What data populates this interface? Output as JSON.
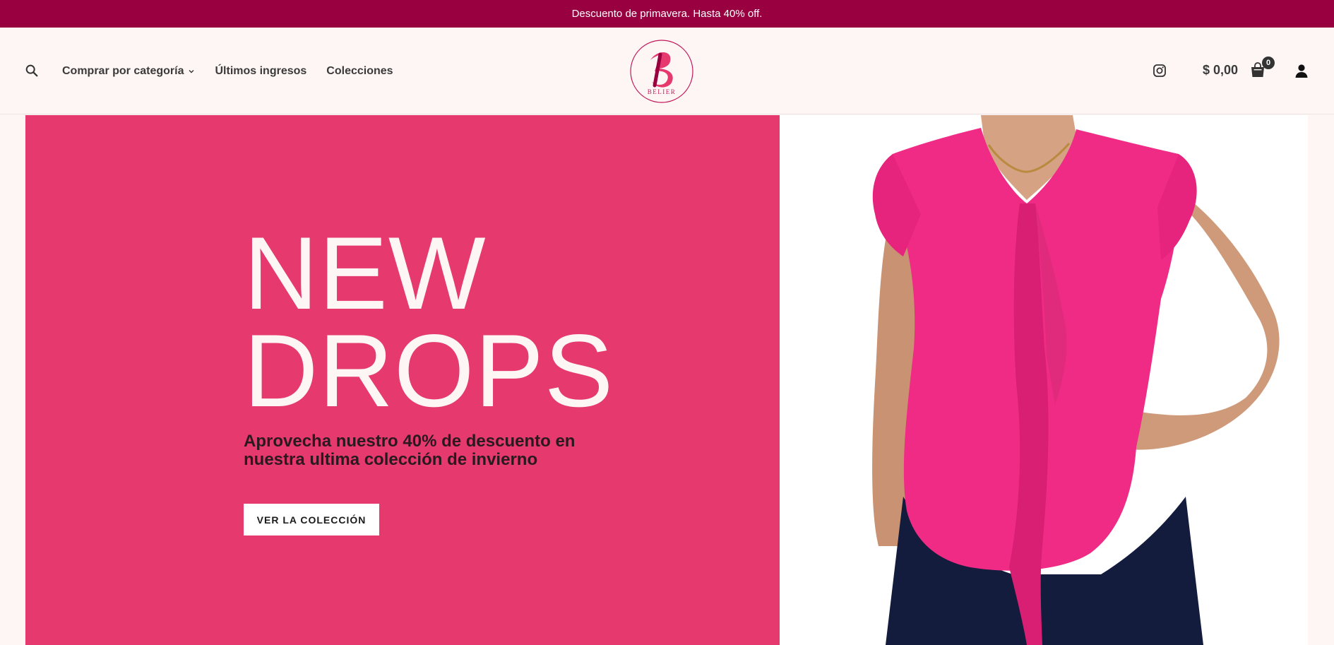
{
  "announcement": {
    "text": "Descuento de primavera. Hasta 40% off."
  },
  "header": {
    "nav": [
      {
        "label": "Comprar por categoría",
        "has_dropdown": true,
        "icon": "chevron-down-icon"
      },
      {
        "label": "Últimos ingresos"
      },
      {
        "label": "Colecciones"
      }
    ],
    "logo": {
      "text": "BELIER",
      "icon": "belier-logo"
    },
    "cart": {
      "total": "$ 0,00",
      "count": "0"
    },
    "icons": [
      "search-icon",
      "instagram-icon",
      "shopping-bag-icon",
      "user-icon"
    ]
  },
  "hero": {
    "title_line1": "NEW",
    "title_line2": "DROPS",
    "subtitle": "Aprovecha nuestro 40% de descuento en nuestra ultima colección de invierno",
    "cta_label": "VER LA COLECCIÓN",
    "image": "woman-pink-blouse-photo"
  },
  "colors": {
    "announcement_bg": "#990040",
    "hero_bg": "#e6396e",
    "page_bg": "#fdf6f4",
    "blouse": "#f02b86"
  }
}
